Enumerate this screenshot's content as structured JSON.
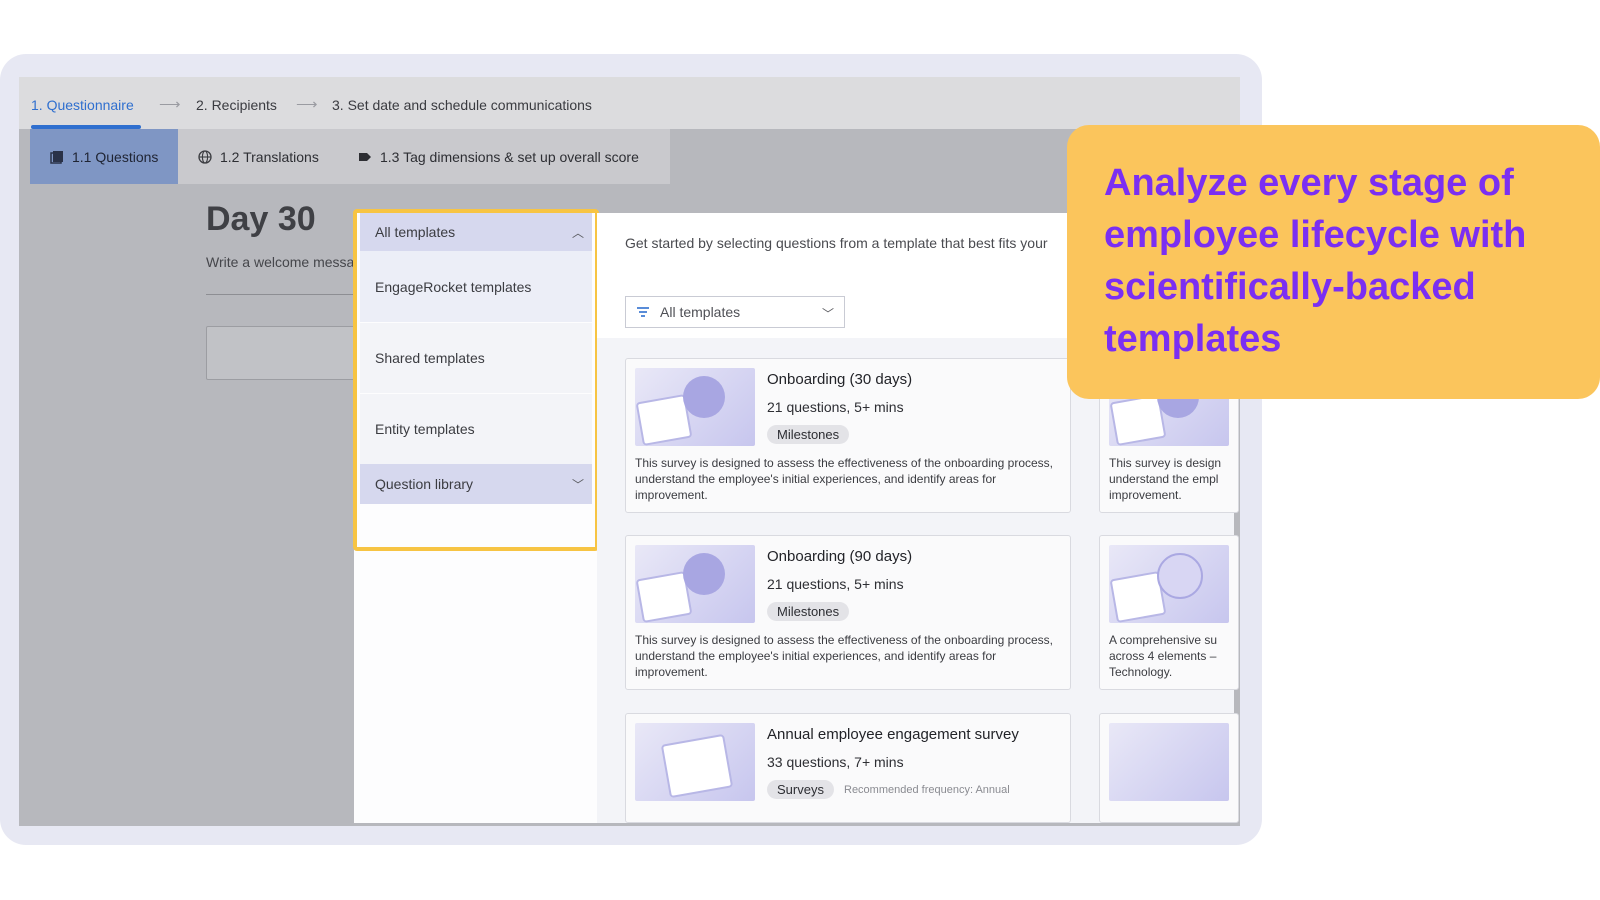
{
  "steps": [
    {
      "label": "1. Questionnaire",
      "active": true
    },
    {
      "label": "2. Recipients",
      "active": false
    },
    {
      "label": "3. Set date and schedule communications",
      "active": false
    }
  ],
  "subtabs": [
    {
      "label": "1.1 Questions",
      "icon": "document-stack-icon"
    },
    {
      "label": "1.2 Translations",
      "icon": "globe-icon"
    },
    {
      "label": "1.3 Tag dimensions & set up overall score",
      "icon": "tag-icon"
    }
  ],
  "page": {
    "title": "Day 30",
    "welcome_text": "Write a welcome messag"
  },
  "menu": {
    "all_templates": "All templates",
    "engagerocket_templates": "EngageRocket templates",
    "shared_templates": "Shared templates",
    "entity_templates": "Entity templates",
    "question_library": "Question library"
  },
  "content": {
    "intro": "Get started by selecting questions from a template that best fits your",
    "filter_value": "All templates"
  },
  "cards": [
    {
      "title": "Onboarding (30 days)",
      "meta": "21 questions, 5+ mins",
      "badge": "Milestones",
      "desc": "This survey is designed to assess the effectiveness of the onboarding process, understand the employee's initial experiences, and identify areas for improvement."
    },
    {
      "title": "Onboarding (90 days)",
      "meta": "21 questions, 5+ mins",
      "badge": "Milestones",
      "desc": "This survey is designed to assess the effectiveness of the onboarding process, understand the employee's initial experiences, and identify areas for improvement."
    },
    {
      "title": "Annual employee engagement survey",
      "meta": "33 questions, 7+ mins",
      "badge": "Surveys",
      "freq": "Recommended frequency: Annual"
    }
  ],
  "partial_cards": [
    {
      "desc": "This survey is design understand the empl improvement."
    },
    {
      "desc": "A comprehensive su across 4 elements – Technology."
    },
    {
      "desc": ""
    }
  ],
  "callout": {
    "text": "Analyze every stage of employee lifecycle with scientifically-backed templates"
  },
  "colors": {
    "accent": "#2f6fcf",
    "callout_bg": "#fbc55c",
    "callout_text": "#7b2ff2",
    "highlight": "#f7c443"
  }
}
